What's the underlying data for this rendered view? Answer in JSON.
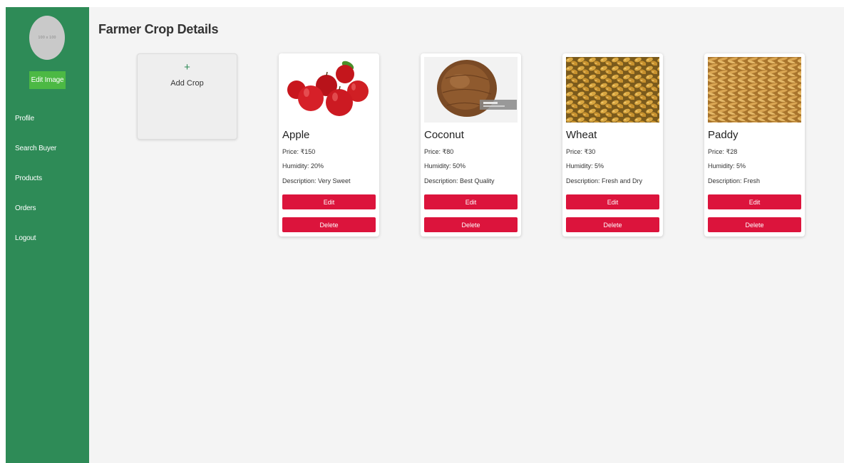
{
  "sidebar": {
    "avatar_text": "100 x 100",
    "edit_image_label": "Edit Image",
    "nav": [
      "Profile",
      "Search Buyer",
      "Products",
      "Orders",
      "Logout"
    ]
  },
  "main": {
    "title": "Farmer Crop Details",
    "add_crop": {
      "icon": "+",
      "label": "Add Crop"
    },
    "crops": [
      {
        "name": "Apple",
        "price": "Price: ₹150",
        "humidity": "Humidity: 20%",
        "description": "Description: Very Sweet"
      },
      {
        "name": "Coconut",
        "price": "Price: ₹80",
        "humidity": "Humidity: 50%",
        "description": "Description: Best Quality"
      },
      {
        "name": "Wheat",
        "price": "Price: ₹30",
        "humidity": "Humidity: 5%",
        "description": "Description: Fresh and Dry"
      },
      {
        "name": "Paddy",
        "price": "Price: ₹28",
        "humidity": "Humidity: 5%",
        "description": "Description: Fresh"
      }
    ],
    "edit_label": "Edit",
    "delete_label": "Delete"
  },
  "colors": {
    "sidebar": "#2e8b57",
    "accent_green": "#4cb944",
    "danger": "#dc143c",
    "background": "#f4f4f4"
  }
}
